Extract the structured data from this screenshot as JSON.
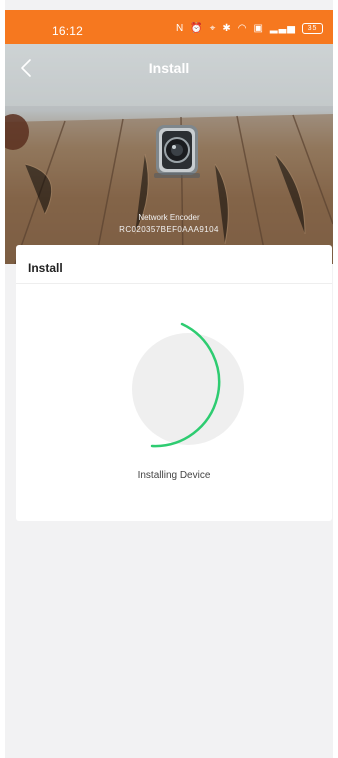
{
  "status_bar": {
    "time": "16:12",
    "icons": [
      "nfc-icon",
      "alarm-icon",
      "location-icon",
      "bluetooth-icon",
      "wifi-icon",
      "sim-icon",
      "signal-icon",
      "battery-icon"
    ],
    "battery_level": "35",
    "background_color": "#f6781f"
  },
  "nav": {
    "title": "Install",
    "back_icon": "chevron-left-icon"
  },
  "device": {
    "name": "Network Encoder",
    "serial": "RC020357BEF0AAA9104"
  },
  "install_card": {
    "header": "Install",
    "status_text": "Installing Device",
    "progress_color": "#2ecc71"
  }
}
